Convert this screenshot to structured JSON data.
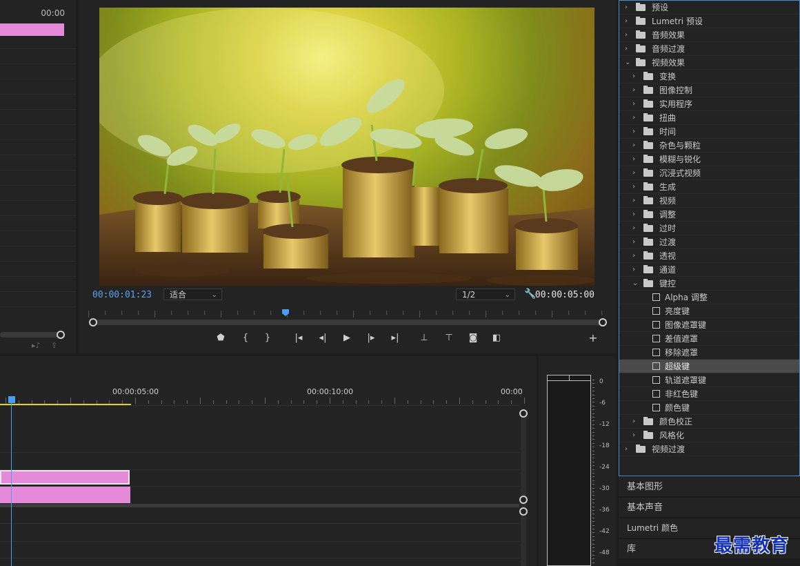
{
  "source_monitor": {
    "timecode": "00:00"
  },
  "program_monitor": {
    "current_timecode": "00:00:01:23",
    "duration_timecode": "00:00:05:00",
    "fit_select": "适合",
    "resolution_select": "1/2"
  },
  "timeline": {
    "ruler": [
      "00:00:05:00",
      "00:00:10:00",
      "00:00"
    ]
  },
  "audio_meter": {
    "db_scale": [
      "0",
      "-6",
      "-12",
      "-18",
      "-24",
      "-30",
      "-36",
      "-42",
      "-48"
    ]
  },
  "effects_panel": {
    "items": [
      {
        "label": "预设",
        "level": 0,
        "kind": "preset-folder",
        "expanded": false
      },
      {
        "label": "Lumetri 预设",
        "level": 0,
        "kind": "preset-folder",
        "expanded": false
      },
      {
        "label": "音频效果",
        "level": 0,
        "kind": "folder",
        "expanded": false
      },
      {
        "label": "音频过渡",
        "level": 0,
        "kind": "folder",
        "expanded": false
      },
      {
        "label": "视频效果",
        "level": 0,
        "kind": "folder",
        "expanded": true
      },
      {
        "label": "变换",
        "level": 1,
        "kind": "folder",
        "expanded": false
      },
      {
        "label": "图像控制",
        "level": 1,
        "kind": "folder",
        "expanded": false
      },
      {
        "label": "实用程序",
        "level": 1,
        "kind": "folder",
        "expanded": false
      },
      {
        "label": "扭曲",
        "level": 1,
        "kind": "folder",
        "expanded": false
      },
      {
        "label": "时间",
        "level": 1,
        "kind": "folder",
        "expanded": false
      },
      {
        "label": "杂色与颗粒",
        "level": 1,
        "kind": "folder",
        "expanded": false
      },
      {
        "label": "模糊与锐化",
        "level": 1,
        "kind": "folder",
        "expanded": false
      },
      {
        "label": "沉浸式视频",
        "level": 1,
        "kind": "folder",
        "expanded": false
      },
      {
        "label": "生成",
        "level": 1,
        "kind": "folder",
        "expanded": false
      },
      {
        "label": "视频",
        "level": 1,
        "kind": "folder",
        "expanded": false
      },
      {
        "label": "调整",
        "level": 1,
        "kind": "folder",
        "expanded": false
      },
      {
        "label": "过时",
        "level": 1,
        "kind": "folder",
        "expanded": false
      },
      {
        "label": "过渡",
        "level": 1,
        "kind": "folder",
        "expanded": false
      },
      {
        "label": "透视",
        "level": 1,
        "kind": "folder",
        "expanded": false
      },
      {
        "label": "通道",
        "level": 1,
        "kind": "folder",
        "expanded": false
      },
      {
        "label": "键控",
        "level": 1,
        "kind": "folder",
        "expanded": true
      },
      {
        "label": "Alpha 调整",
        "level": 2,
        "kind": "effect"
      },
      {
        "label": "亮度键",
        "level": 2,
        "kind": "effect"
      },
      {
        "label": "图像遮罩键",
        "level": 2,
        "kind": "effect"
      },
      {
        "label": "差值遮罩",
        "level": 2,
        "kind": "effect"
      },
      {
        "label": "移除遮罩",
        "level": 2,
        "kind": "effect"
      },
      {
        "label": "超级键",
        "level": 2,
        "kind": "effect",
        "selected": true
      },
      {
        "label": "轨道遮罩键",
        "level": 2,
        "kind": "effect"
      },
      {
        "label": "非红色键",
        "level": 2,
        "kind": "effect"
      },
      {
        "label": "颜色键",
        "level": 2,
        "kind": "effect"
      },
      {
        "label": "颜色校正",
        "level": 1,
        "kind": "folder",
        "expanded": false
      },
      {
        "label": "风格化",
        "level": 1,
        "kind": "folder",
        "expanded": false
      },
      {
        "label": "视频过渡",
        "level": 0,
        "kind": "folder",
        "expanded": false
      }
    ]
  },
  "side_tabs": [
    "基本图形",
    "基本声音",
    "Lumetri 颜色",
    "库"
  ],
  "watermark": "最需教育",
  "colors": {
    "clip": "#e48ad8",
    "playhead": "#4a9ff5",
    "work_area": "#e8d21f",
    "selection_border": "#4a90d9"
  }
}
